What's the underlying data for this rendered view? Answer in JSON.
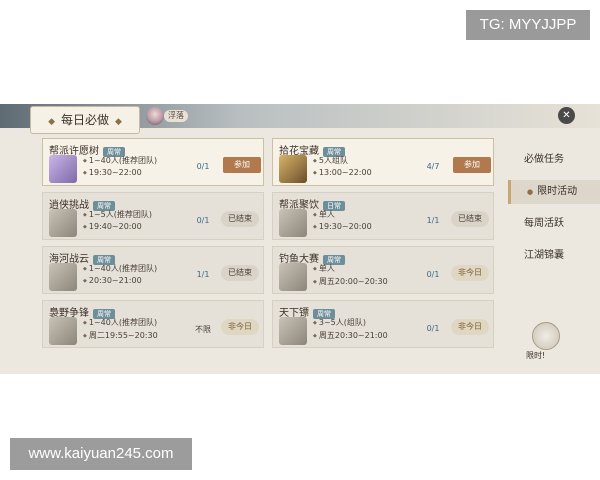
{
  "watermarks": {
    "top": "TG: MYYJJPP",
    "bottom": "www.kaiyuan245.com"
  },
  "header": {
    "title": "每日必做",
    "player_name": "浮落"
  },
  "sidebar": {
    "items": [
      {
        "label": "必做任务"
      },
      {
        "label": "限时活动"
      },
      {
        "label": "每周活跃"
      },
      {
        "label": "江湖锦囊"
      }
    ],
    "limit_label": "限时!"
  },
  "activities": [
    {
      "title": "帮派许愿树",
      "tag": "周常",
      "line1": "1~40人(推荐团队)",
      "line2": "19:30~22:00",
      "count": "0/1",
      "button": "参加",
      "state": "join"
    },
    {
      "title": "拾花宝藏",
      "tag": "周常",
      "line1": "5人组队",
      "line2": "13:00~22:00",
      "count": "4/7",
      "button": "参加",
      "state": "join"
    },
    {
      "title": "逍侠挑战",
      "tag": "周常",
      "line1": "1~5人(推荐团队)",
      "line2": "19:40~20:00",
      "count": "0/1",
      "button": "已结束",
      "state": "ended"
    },
    {
      "title": "帮派聚饮",
      "tag": "日常",
      "line1": "单人",
      "line2": "19:30~20:00",
      "count": "1/1",
      "button": "已结束",
      "state": "ended"
    },
    {
      "title": "海河战云",
      "tag": "周常",
      "line1": "1~40人(推荐团队)",
      "line2": "20:30~21:00",
      "count": "1/1",
      "button": "已结束",
      "state": "ended"
    },
    {
      "title": "钓鱼大赛",
      "tag": "周常",
      "line1": "单人",
      "line2": "周五20:00~20:30",
      "count": "0/1",
      "button": "非今日",
      "state": "notoday"
    },
    {
      "title": "裊野争锋",
      "tag": "周常",
      "line1": "1~40人(推荐团队)",
      "line2": "周二19:55~20:30",
      "count": "不限",
      "button": "非今日",
      "state": "notoday"
    },
    {
      "title": "天下镖",
      "tag": "周常",
      "line1": "3~5人(组队)",
      "line2": "周五20:30~21:00",
      "count": "0/1",
      "button": "非今日",
      "state": "notoday"
    }
  ]
}
